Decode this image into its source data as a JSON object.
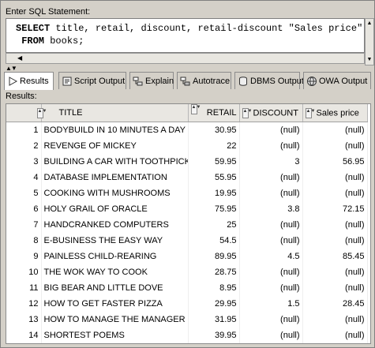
{
  "editor": {
    "label": "Enter SQL Statement:",
    "line1_keyword": "SELECT",
    "line1_rest": " title, retail, discount, retail-discount \"Sales price\"",
    "line2_keyword": "FROM",
    "line2_rest": " books;"
  },
  "tabs": [
    {
      "label": "Results",
      "icon": "results-play-icon",
      "active": true
    },
    {
      "label": "Script Output",
      "icon": "script-output-icon",
      "active": false
    },
    {
      "label": "Explain",
      "icon": "explain-icon",
      "active": false
    },
    {
      "label": "Autotrace",
      "icon": "autotrace-icon",
      "active": false
    },
    {
      "label": "DBMS Output",
      "icon": "dbms-output-icon",
      "active": false
    },
    {
      "label": "OWA Output",
      "icon": "owa-output-icon",
      "active": false
    }
  ],
  "results_label": "Results:",
  "grid": {
    "columns": [
      "TITLE",
      "RETAIL",
      "DISCOUNT",
      "Sales price"
    ],
    "rows": [
      {
        "n": "1",
        "title": "BODYBUILD IN 10 MINUTES A DAY",
        "retail": "30.95",
        "discount": "(null)",
        "sales": "(null)"
      },
      {
        "n": "2",
        "title": "REVENGE OF MICKEY",
        "retail": "22",
        "discount": "(null)",
        "sales": "(null)"
      },
      {
        "n": "3",
        "title": "BUILDING A CAR WITH TOOTHPICKS",
        "retail": "59.95",
        "discount": "3",
        "sales": "56.95"
      },
      {
        "n": "4",
        "title": "DATABASE IMPLEMENTATION",
        "retail": "55.95",
        "discount": "(null)",
        "sales": "(null)"
      },
      {
        "n": "5",
        "title": "COOKING WITH MUSHROOMS",
        "retail": "19.95",
        "discount": "(null)",
        "sales": "(null)"
      },
      {
        "n": "6",
        "title": "HOLY GRAIL OF ORACLE",
        "retail": "75.95",
        "discount": "3.8",
        "sales": "72.15"
      },
      {
        "n": "7",
        "title": "HANDCRANKED COMPUTERS",
        "retail": "25",
        "discount": "(null)",
        "sales": "(null)"
      },
      {
        "n": "8",
        "title": "E-BUSINESS THE EASY WAY",
        "retail": "54.5",
        "discount": "(null)",
        "sales": "(null)"
      },
      {
        "n": "9",
        "title": "PAINLESS CHILD-REARING",
        "retail": "89.95",
        "discount": "4.5",
        "sales": "85.45"
      },
      {
        "n": "10",
        "title": "THE WOK WAY TO COOK",
        "retail": "28.75",
        "discount": "(null)",
        "sales": "(null)"
      },
      {
        "n": "11",
        "title": "BIG BEAR AND LITTLE DOVE",
        "retail": "8.95",
        "discount": "(null)",
        "sales": "(null)"
      },
      {
        "n": "12",
        "title": "HOW TO GET FASTER PIZZA",
        "retail": "29.95",
        "discount": "1.5",
        "sales": "28.45"
      },
      {
        "n": "13",
        "title": "HOW TO MANAGE THE MANAGER",
        "retail": "31.95",
        "discount": "(null)",
        "sales": "(null)"
      },
      {
        "n": "14",
        "title": "SHORTEST POEMS",
        "retail": "39.95",
        "discount": "(null)",
        "sales": "(null)"
      }
    ]
  },
  "colors": {
    "panel_bg": "#d4d0c8",
    "header_bg": "#e9e7e2"
  }
}
